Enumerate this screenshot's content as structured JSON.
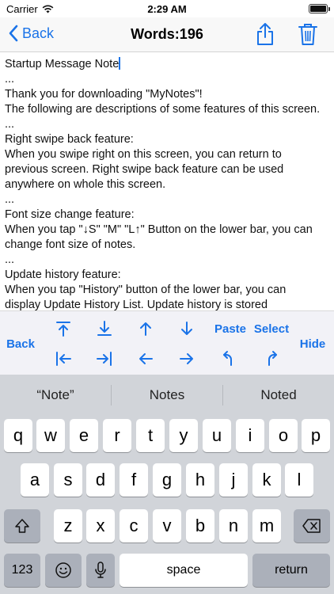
{
  "status": {
    "carrier": "Carrier",
    "time": "2:29 AM"
  },
  "navbar": {
    "back_label": "Back",
    "title": "Words:196"
  },
  "note": {
    "lines": [
      "Startup Message Note",
      "...",
      "Thank you for downloading \"MyNotes\"!",
      "The following are descriptions of some features of this screen.",
      "...",
      "Right swipe back feature:",
      "When you swipe right on this screen, you can return to",
      "previous screen. Right swipe back feature can be used",
      "anywhere on whole this screen.",
      "...",
      "Font size change feature:",
      "When you tap \"↓S\" \"M\" \"L↑\" Button on the lower bar, you can",
      "change font size of notes.",
      "...",
      "Update history feature:",
      "When you tap \"History\" button of the lower bar, you can",
      "display Update History List. Update history is stored"
    ]
  },
  "toolbar": {
    "back": "Back",
    "paste": "Paste",
    "select": "Select",
    "hide": "Hide"
  },
  "keyboard": {
    "suggestions": [
      "“Note”",
      "Notes",
      "Noted"
    ],
    "row1": [
      "q",
      "w",
      "e",
      "r",
      "t",
      "y",
      "u",
      "i",
      "o",
      "p"
    ],
    "row2": [
      "a",
      "s",
      "d",
      "f",
      "g",
      "h",
      "j",
      "k",
      "l"
    ],
    "row3": [
      "z",
      "x",
      "c",
      "v",
      "b",
      "n",
      "m"
    ],
    "num": "123",
    "space": "space",
    "return": "return"
  },
  "colors": {
    "accent": "#1a73e8",
    "keyboard_bg": "#d1d4d9",
    "toolbar_bg": "#f2f2f7"
  }
}
